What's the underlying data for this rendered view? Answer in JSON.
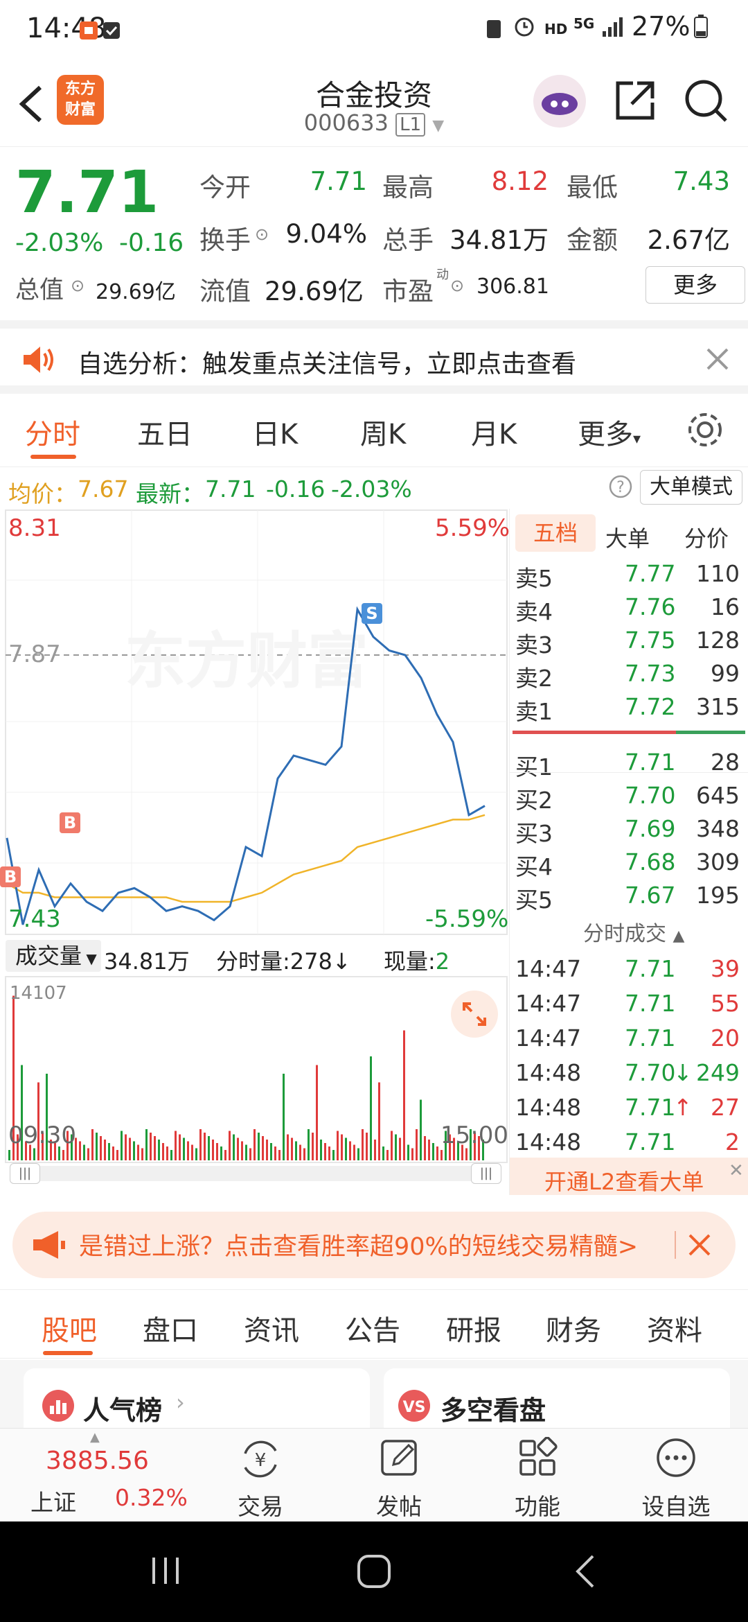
{
  "status_bar": {
    "time": "14:48",
    "network": "HD",
    "signal": "5G",
    "battery": "27%"
  },
  "header": {
    "title": "合金投资",
    "code": "000633",
    "level_badge": "L1",
    "app_logo_line1": "东方",
    "app_logo_line2": "财富"
  },
  "quote": {
    "price": "7.71",
    "change_pct": "-2.03%",
    "change": "-0.16",
    "open_label": "今开",
    "open": "7.71",
    "high_label": "最高",
    "high": "8.12",
    "low_label": "最低",
    "low": "7.43",
    "turnover_label": "换手",
    "turnover": "9.04%",
    "volume_label": "总手",
    "volume": "34.81万",
    "amount_label": "金额",
    "amount": "2.67亿",
    "mktcap_label": "总值",
    "mktcap": "29.69亿",
    "float_label": "流值",
    "float_cap": "29.69亿",
    "pe_label": "市盈",
    "pe_sup": "动",
    "pe": "306.81",
    "more_button": "更多"
  },
  "notice": {
    "text": "自选分析：触发重点关注信号，立即点击查看"
  },
  "period_tabs": [
    "分时",
    "五日",
    "日K",
    "周K",
    "月K",
    "更多"
  ],
  "active_period": "分时",
  "info_line": {
    "avg_label": "均价：",
    "avg": "7.67",
    "latest_label": "最新：",
    "latest": "7.71",
    "change": "-0.16",
    "change_pct": "-2.03%",
    "mode_button": "大单模式"
  },
  "chart": {
    "y_top": "8.31",
    "y_top_pct": "5.59%",
    "y_mid": "7.87",
    "y_bottom": "7.43",
    "y_bottom_pct": "-5.59%",
    "watermark": "东方财富",
    "marker_buy": "B",
    "marker_sell": "S",
    "volume_label": "成交量",
    "volume_total": "34.81万",
    "minute_vol_label": "分时量:",
    "minute_vol": "278",
    "current_vol_label": "现量:",
    "current_vol": "2",
    "volume_max": "14107",
    "time_start": "09:30",
    "time_end": "15:00",
    "colors": {
      "price_line": "#2e6db4",
      "avg_line": "#f0b429",
      "up": "#e03a3a",
      "down": "#1d9b3a"
    }
  },
  "chart_data": {
    "type": "line",
    "series": [
      {
        "values": [
          7.62,
          7.43,
          7.55,
          7.47,
          7.52,
          7.48,
          7.46,
          7.5,
          7.51,
          7.49,
          7.46,
          7.47,
          7.46,
          7.44,
          7.47,
          7.6,
          7.58,
          7.75,
          7.8,
          7.79,
          7.78,
          7.82,
          8.12,
          8.06,
          8.03,
          8.02,
          7.97,
          7.89,
          7.83,
          7.67,
          7.69
        ]
      },
      {
        "values": [
          7.52,
          7.5,
          7.5,
          7.49,
          7.49,
          7.49,
          7.49,
          7.49,
          7.49,
          7.49,
          7.49,
          7.48,
          7.48,
          7.48,
          7.48,
          7.49,
          7.5,
          7.52,
          7.54,
          7.55,
          7.56,
          7.57,
          7.6,
          7.61,
          7.62,
          7.63,
          7.64,
          7.65,
          7.66,
          7.66,
          7.67
        ]
      }
    ],
    "ylim": [
      7.43,
      8.31
    ]
  },
  "book_tabs": [
    "五档",
    "大单",
    "分价"
  ],
  "asks": [
    {
      "label": "卖5",
      "price": "7.77",
      "vol": "110"
    },
    {
      "label": "卖4",
      "price": "7.76",
      "vol": "16"
    },
    {
      "label": "卖3",
      "price": "7.75",
      "vol": "128"
    },
    {
      "label": "卖2",
      "price": "7.73",
      "vol": "99"
    },
    {
      "label": "卖1",
      "price": "7.72",
      "vol": "315"
    }
  ],
  "bids": [
    {
      "label": "买1",
      "price": "7.71",
      "vol": "28"
    },
    {
      "label": "买2",
      "price": "7.70",
      "vol": "645"
    },
    {
      "label": "买3",
      "price": "7.69",
      "vol": "348"
    },
    {
      "label": "买4",
      "price": "7.68",
      "vol": "309"
    },
    {
      "label": "买5",
      "price": "7.67",
      "vol": "195"
    }
  ],
  "trades_title": "分时成交",
  "trades": [
    {
      "time": "14:47",
      "price": "7.71",
      "vol": "39",
      "arrow": ""
    },
    {
      "time": "14:47",
      "price": "7.71",
      "vol": "55",
      "arrow": ""
    },
    {
      "time": "14:47",
      "price": "7.71",
      "vol": "20",
      "arrow": ""
    },
    {
      "time": "14:48",
      "price": "7.70",
      "vol": "249",
      "arrow": "↓"
    },
    {
      "time": "14:48",
      "price": "7.71",
      "vol": "27",
      "arrow": "↑"
    },
    {
      "time": "14:48",
      "price": "7.71",
      "vol": "2",
      "arrow": ""
    }
  ],
  "l2_button": "开通L2查看大单",
  "banner": {
    "text": "是错过上涨？点击查看胜率超90%的短线交易精髓>"
  },
  "sub_tabs": [
    "股吧",
    "盘口",
    "资讯",
    "公告",
    "研报",
    "财务",
    "资料"
  ],
  "active_sub_tab": "股吧",
  "cards": [
    {
      "title": "人气榜"
    },
    {
      "title": "多空看盘"
    }
  ],
  "bottom_nav": {
    "index_value": "3885.56",
    "index_name": "上证",
    "index_change": "0.32%",
    "items": [
      "交易",
      "发帖",
      "功能",
      "设自选"
    ]
  }
}
